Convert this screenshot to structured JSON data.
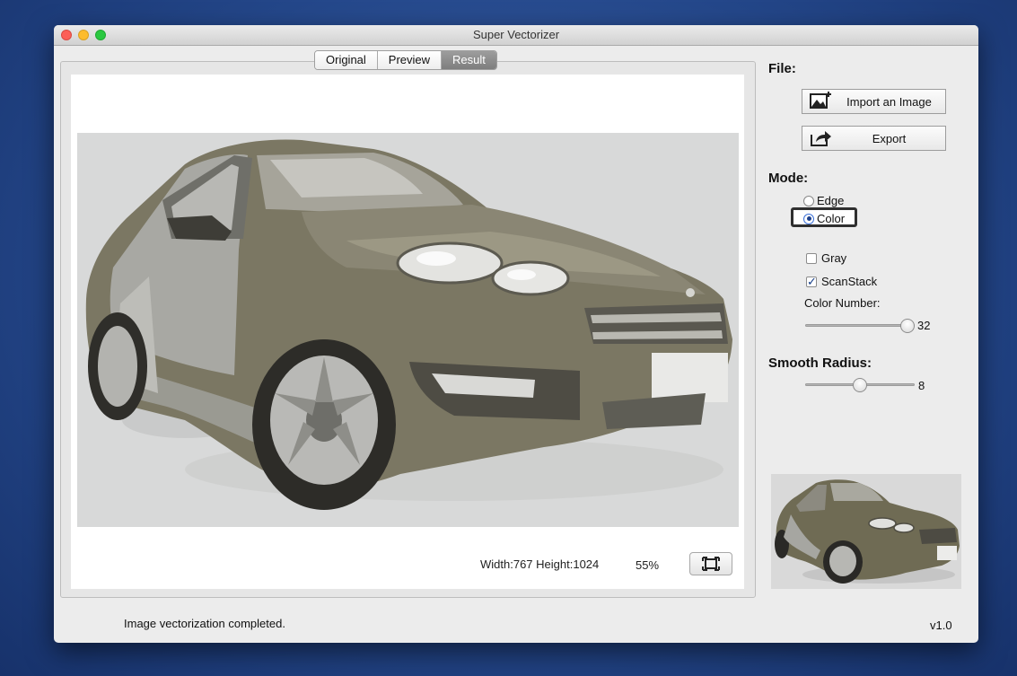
{
  "window": {
    "title": "Super Vectorizer"
  },
  "tabs": [
    {
      "label": "Original",
      "active": false
    },
    {
      "label": "Preview",
      "active": false
    },
    {
      "label": "Result",
      "active": true
    }
  ],
  "canvas": {
    "dimensions": "Width:767 Height:1024",
    "zoom": "55%",
    "fit_icon": "fit-to-window-icon"
  },
  "file": {
    "label": "File:",
    "import_label": "Import an Image",
    "import_icon": "image-import-icon",
    "export_label": "Export",
    "export_icon": "share-export-icon"
  },
  "mode": {
    "label": "Mode:",
    "options": [
      {
        "label": "Edge",
        "selected": false
      },
      {
        "label": "Color",
        "selected": true
      }
    ]
  },
  "options": {
    "gray": {
      "label": "Gray",
      "checked": false
    },
    "scanstack": {
      "label": "ScanStack",
      "checked": true
    }
  },
  "color_number": {
    "label": "Color Number:",
    "value": "32",
    "fraction": 1.0
  },
  "smooth_radius": {
    "label": "Smooth Radius:",
    "value": "8",
    "fraction": 0.5
  },
  "status": {
    "message": "Image vectorization completed.",
    "version": "v1.0"
  },
  "colors": {
    "car_body": "#7b7763",
    "selected_tab": "#8a8a8a",
    "focus_ring": "#2f2f2f"
  }
}
